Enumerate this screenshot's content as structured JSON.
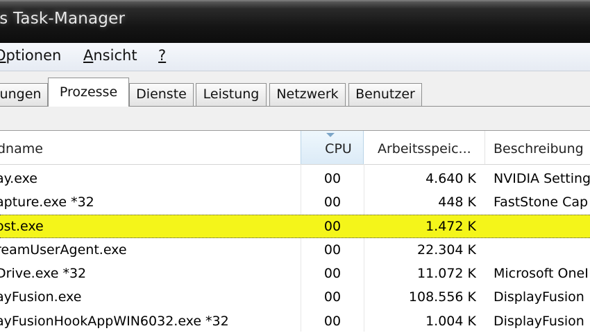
{
  "window": {
    "title": "ows Task-Manager"
  },
  "menu": {
    "items": [
      {
        "before": "",
        "underlined": "O",
        "after": "ptionen"
      },
      {
        "before": "",
        "underlined": "A",
        "after": "nsicht"
      },
      {
        "before": "",
        "underlined": "?",
        "after": ""
      }
    ]
  },
  "tabs": [
    {
      "label": "ungen"
    },
    {
      "label": "Prozesse",
      "active": true
    },
    {
      "label": "Dienste"
    },
    {
      "label": "Leistung"
    },
    {
      "label": "Netzwerk"
    },
    {
      "label": "Benutzer"
    }
  ],
  "table": {
    "columns": {
      "name": "dname",
      "cpu": "CPU",
      "memory": "Arbeitsspeic...",
      "description": "Beschreibung"
    },
    "sorted_column": "cpu",
    "rows": [
      {
        "name": "ay.exe",
        "cpu": "00",
        "memory": "4.640 K",
        "description": "NVIDIA Setting"
      },
      {
        "name": "apture.exe *32",
        "cpu": "00",
        "memory": "448 K",
        "description": "FastStone Cap"
      },
      {
        "name": "ost.exe",
        "cpu": "00",
        "memory": "1.472 K",
        "description": "",
        "selected": true
      },
      {
        "name": "reamUserAgent.exe",
        "cpu": "00",
        "memory": "22.304 K",
        "description": ""
      },
      {
        "name": "Drive.exe *32",
        "cpu": "00",
        "memory": "11.072 K",
        "description": "Microsoft OneI"
      },
      {
        "name": "ayFusion.exe",
        "cpu": "00",
        "memory": "108.556 K",
        "description": "DisplayFusion"
      },
      {
        "name": "ayFusionHookAppWIN6032.exe *32",
        "cpu": "00",
        "memory": "1.004 K",
        "description": "DisplayFusion"
      }
    ]
  },
  "colors": {
    "selection_highlight": "#f4f51a",
    "titlebar": "#151515"
  }
}
